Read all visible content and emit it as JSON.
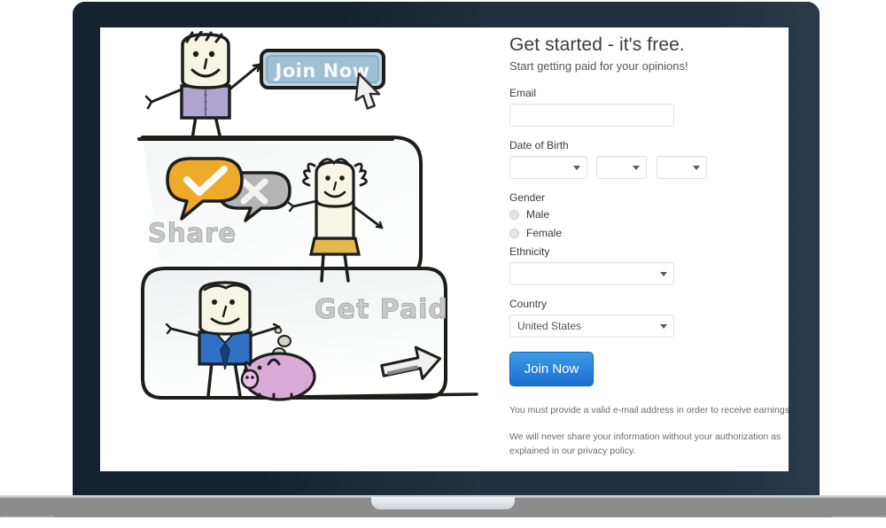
{
  "device": {
    "type": "laptop-mockup"
  },
  "form": {
    "headline": "Get started - it's free.",
    "subhead": "Start getting paid for your opinions!",
    "email": {
      "label": "Email",
      "value": "",
      "placeholder": ""
    },
    "dob": {
      "label": "Date of Birth",
      "month": "",
      "day": "",
      "year": ""
    },
    "gender": {
      "label": "Gender",
      "options": [
        "Male",
        "Female"
      ],
      "selected": ""
    },
    "ethnicity": {
      "label": "Ethnicity",
      "value": ""
    },
    "country": {
      "label": "Country",
      "value": "United States"
    },
    "submit_label": "Join Now",
    "legal": [
      "You must provide a valid e-mail address in order to receive earnings.",
      "We will never share your information without your authorization as explained in our privacy policy."
    ],
    "accent_color": "#2f8ade"
  },
  "illustration": {
    "panels": [
      {
        "caption": "Join Now",
        "type": "button-click"
      },
      {
        "caption": "Share",
        "type": "opinion-bubbles"
      },
      {
        "caption": "Get Paid",
        "type": "piggy-bank"
      }
    ],
    "colors": {
      "button_blue": "#9cc3d8",
      "bubble_yellow": "#f0ad2e",
      "bubble_gray": "#adadad",
      "shirt_purple": "#b0a5d0",
      "skirt_gold": "#e6b94f",
      "suit_blue": "#2f6fc4",
      "piggy_pink": "#d9a9d8",
      "ink": "#1d1d1b"
    }
  }
}
